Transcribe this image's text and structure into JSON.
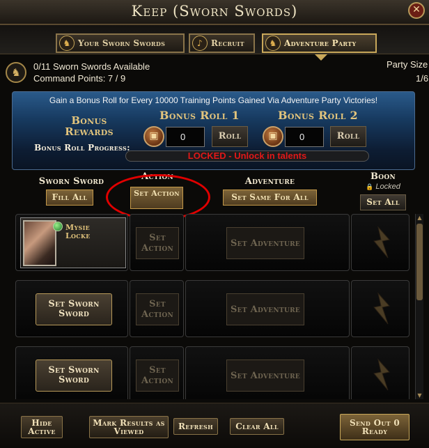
{
  "window": {
    "title": "Keep (Sworn Swords)",
    "close_glyph": "✕"
  },
  "tabs": [
    {
      "label": "Your Sworn Swords",
      "icon": "helm-icon",
      "glyph": "♞",
      "active": false
    },
    {
      "label": "Recruit",
      "icon": "horn-icon",
      "glyph": "♪",
      "active": false
    },
    {
      "label": "Adventure Party",
      "icon": "helm-icon",
      "glyph": "♞",
      "active": true
    }
  ],
  "status": {
    "available": "0/11 Sworn Swords Available",
    "command_points": "Command Points: 7 / 9",
    "party_size_label": "Party Size",
    "party_size_value": "1/6",
    "emblem_glyph": "♞"
  },
  "bonus": {
    "banner": "Gain a Bonus Roll for Every 10000 Training Points Gained Via Adventure Party Victories!",
    "rewards_label": "Bonus Rewards",
    "progress_label": "Bonus Roll Progress:",
    "roll1": {
      "title": "Bonus Roll 1",
      "count": "0",
      "button": "Roll"
    },
    "roll2": {
      "title": "Bonus Roll 2",
      "count": "0",
      "button": "Roll"
    },
    "progress_text": "LOCKED - Unlock in talents",
    "chest_glyph": "▣"
  },
  "columns": {
    "sworn_sword": "Sworn Sword",
    "action": "Action",
    "adventure": "Adventure",
    "boon": "Boon",
    "boon_locked": "Locked",
    "lock_glyph": "🔒",
    "fill_all": "Fill All",
    "set_action": "Set Action",
    "set_same_for_all": "Set Same For All",
    "set_all": "Set All"
  },
  "rows": [
    {
      "name": "Mysie Locke",
      "set_sword": "",
      "action": "Set Action",
      "adventure": "Set Adventure"
    },
    {
      "name": "",
      "set_sword": "Set Sworn Sword",
      "action": "Set Action",
      "adventure": "Set Adventure"
    },
    {
      "name": "",
      "set_sword": "Set Sworn Sword",
      "action": "Set Action",
      "adventure": "Set Adventure"
    }
  ],
  "scroll": {
    "up_glyph": "▲",
    "down_glyph": "▼"
  },
  "footer": {
    "hide_active": "Hide Active",
    "mark_results": "Mark Results as Viewed",
    "refresh": "Refresh",
    "clear_all": "Clear All",
    "send_out": "Send Out 0 Ready"
  },
  "colors": {
    "accent_gold": "#c9a85a",
    "locked_red": "#e01818",
    "panel_blue": "#173a60",
    "highlight_red": "#e00000"
  }
}
